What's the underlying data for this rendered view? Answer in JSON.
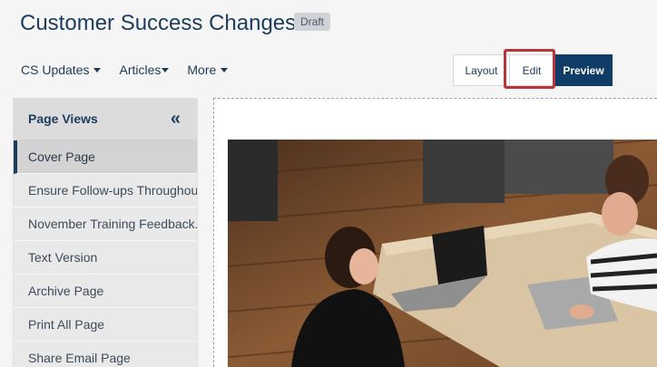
{
  "page": {
    "title": "Customer Success Changes",
    "status_badge": "Draft"
  },
  "nav": [
    {
      "label": "CS Updates",
      "has_dropdown": true
    },
    {
      "label": "Articles",
      "has_dropdown": true
    },
    {
      "label": "More",
      "has_dropdown": true
    }
  ],
  "modes": {
    "layout": "Layout",
    "edit": "Edit",
    "preview": "Preview",
    "active": "Preview",
    "highlighted": "Edit"
  },
  "sidebar": {
    "header": "Page Views",
    "collapse_icon": "double-chevron-left",
    "items": [
      {
        "label": "Cover Page",
        "active": true
      },
      {
        "label": "Ensure Follow-ups Throughout"
      },
      {
        "label": "November Training Feedback..."
      },
      {
        "label": "Text Version"
      },
      {
        "label": "Archive Page"
      },
      {
        "label": "Print All Page"
      },
      {
        "label": "Share Email Page"
      }
    ]
  },
  "canvas": {
    "image_subject": "two women working at a wooden table with laptops"
  },
  "colors": {
    "primary": "#0f3d67",
    "title": "#1d3c5c",
    "highlight": "#b8333a",
    "sidebar_bg": "#e9e9e9"
  }
}
